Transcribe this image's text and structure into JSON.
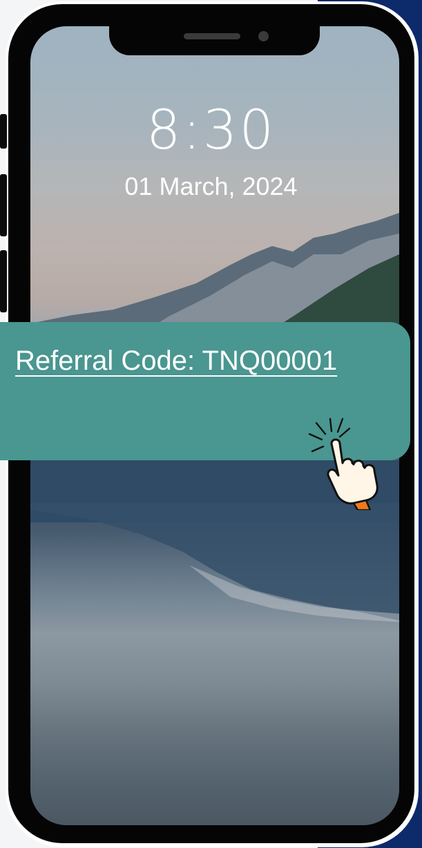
{
  "lock_screen": {
    "time": "8:30",
    "date": "01 March, 2024"
  },
  "referral": {
    "label": "Referral Code: TNQ00001"
  },
  "icons": {
    "pointer": "pointing-hand-click-icon"
  },
  "colors": {
    "banner": "#4a9690",
    "frame": "#050505",
    "accent": "#0d2a6b",
    "cuff": "#f07a1e"
  }
}
